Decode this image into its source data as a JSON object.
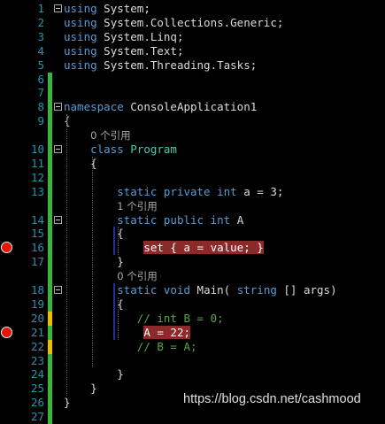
{
  "editor": {
    "lines": [
      {
        "num": "1",
        "fold": true,
        "parts": [
          [
            "kw",
            "using"
          ],
          [
            "",
            "System;"
          ]
        ]
      },
      {
        "num": "2",
        "parts": [
          [
            "kw",
            "using"
          ],
          [
            "",
            "System.Collections.Generic;"
          ]
        ]
      },
      {
        "num": "3",
        "parts": [
          [
            "kw",
            "using"
          ],
          [
            "",
            "System.Linq;"
          ]
        ]
      },
      {
        "num": "4",
        "parts": [
          [
            "kw",
            "using"
          ],
          [
            "",
            "System.Text;"
          ]
        ]
      },
      {
        "num": "5",
        "parts": [
          [
            "kw",
            "using"
          ],
          [
            "",
            "System.Threading.Tasks;"
          ]
        ]
      },
      {
        "num": "6",
        "parts": []
      },
      {
        "num": "7",
        "parts": []
      },
      {
        "num": "8",
        "fold": true,
        "parts": [
          [
            "kw",
            "namespace"
          ],
          [
            "",
            "ConsoleApplication1"
          ]
        ]
      },
      {
        "num": "9",
        "parts": [
          [
            "",
            "{"
          ]
        ]
      },
      {
        "num": "",
        "ref": true,
        "indent": "    ",
        "parts": [
          [
            "ref",
            "0 个引用"
          ]
        ]
      },
      {
        "num": "10",
        "fold": true,
        "indent": "    ",
        "parts": [
          [
            "kw",
            "class"
          ],
          [
            "ty",
            "Program"
          ]
        ]
      },
      {
        "num": "11",
        "indent": "    ",
        "parts": [
          [
            "",
            "{"
          ]
        ]
      },
      {
        "num": "12",
        "parts": []
      },
      {
        "num": "13",
        "indent": "        ",
        "parts": [
          [
            "kw",
            "static"
          ],
          [
            "kw",
            "private"
          ],
          [
            "kw",
            "int"
          ],
          [
            "",
            "a = 3;"
          ]
        ]
      },
      {
        "num": "",
        "ref": true,
        "indent": "        ",
        "parts": [
          [
            "ref",
            "1 个引用"
          ]
        ]
      },
      {
        "num": "14",
        "fold": true,
        "indent": "        ",
        "parts": [
          [
            "kw",
            "static"
          ],
          [
            "kw",
            "public"
          ],
          [
            "kw",
            "int"
          ],
          [
            "",
            "A"
          ]
        ]
      },
      {
        "num": "15",
        "indent": "        ",
        "parts": [
          [
            "",
            "{"
          ]
        ]
      },
      {
        "num": "16",
        "bp": true,
        "indent": "            ",
        "parts": [
          [
            "hl",
            "set { a = value; }"
          ]
        ]
      },
      {
        "num": "17",
        "indent": "        ",
        "parts": [
          [
            "",
            "}"
          ]
        ]
      },
      {
        "num": "",
        "ref": true,
        "indent": "        ",
        "parts": [
          [
            "ref",
            "0 个引用"
          ]
        ]
      },
      {
        "num": "18",
        "fold": true,
        "indent": "        ",
        "parts": [
          [
            "kw",
            "static"
          ],
          [
            "kw",
            "void"
          ],
          [
            "",
            "Main("
          ],
          [
            "kw",
            "string"
          ],
          [
            "",
            "[] args)"
          ]
        ]
      },
      {
        "num": "19",
        "indent": "        ",
        "parts": [
          [
            "",
            "{"
          ]
        ]
      },
      {
        "num": "20",
        "indent": "           ",
        "parts": [
          [
            "cm",
            "// int B = 0;"
          ]
        ]
      },
      {
        "num": "21",
        "bp": true,
        "indent": "            ",
        "parts": [
          [
            "hl",
            "A = 22;"
          ]
        ]
      },
      {
        "num": "22",
        "indent": "           ",
        "parts": [
          [
            "cm",
            "// B = A;"
          ]
        ]
      },
      {
        "num": "23",
        "parts": []
      },
      {
        "num": "24",
        "indent": "        ",
        "parts": [
          [
            "",
            "}"
          ]
        ]
      },
      {
        "num": "25",
        "indent": "    ",
        "parts": [
          [
            "",
            "}"
          ]
        ]
      },
      {
        "num": "26",
        "parts": [
          [
            "",
            "}"
          ]
        ]
      },
      {
        "num": "27",
        "parts": []
      }
    ]
  },
  "change_marks": {
    "1": "none",
    "2": "none",
    "3": "none",
    "4": "none",
    "5": "none",
    "6": "green",
    "7": "green",
    "8": "green",
    "9": "green",
    "10": "green",
    "11": "green",
    "12": "green",
    "13": "green",
    "14": "green",
    "15": "green",
    "16": "green",
    "17": "green",
    "18": "green",
    "19": "green",
    "20": "yellow",
    "21": "green",
    "22": "yellow",
    "23": "green",
    "24": "green",
    "25": "green",
    "26": "green",
    "27": "green"
  },
  "colors": {
    "background": "#000000",
    "line_number": "#2b91af",
    "keyword": "#569cd6",
    "type": "#4ec9b0",
    "comment": "#57a64a",
    "text": "#dcdcdc",
    "breakpoint": "#e51400",
    "breakpoint_highlight": "#8b2a2a",
    "change_saved": "#3cb43c",
    "change_unsaved": "#e8c000"
  },
  "watermark": "https://blog.csdn.net/cashmood"
}
